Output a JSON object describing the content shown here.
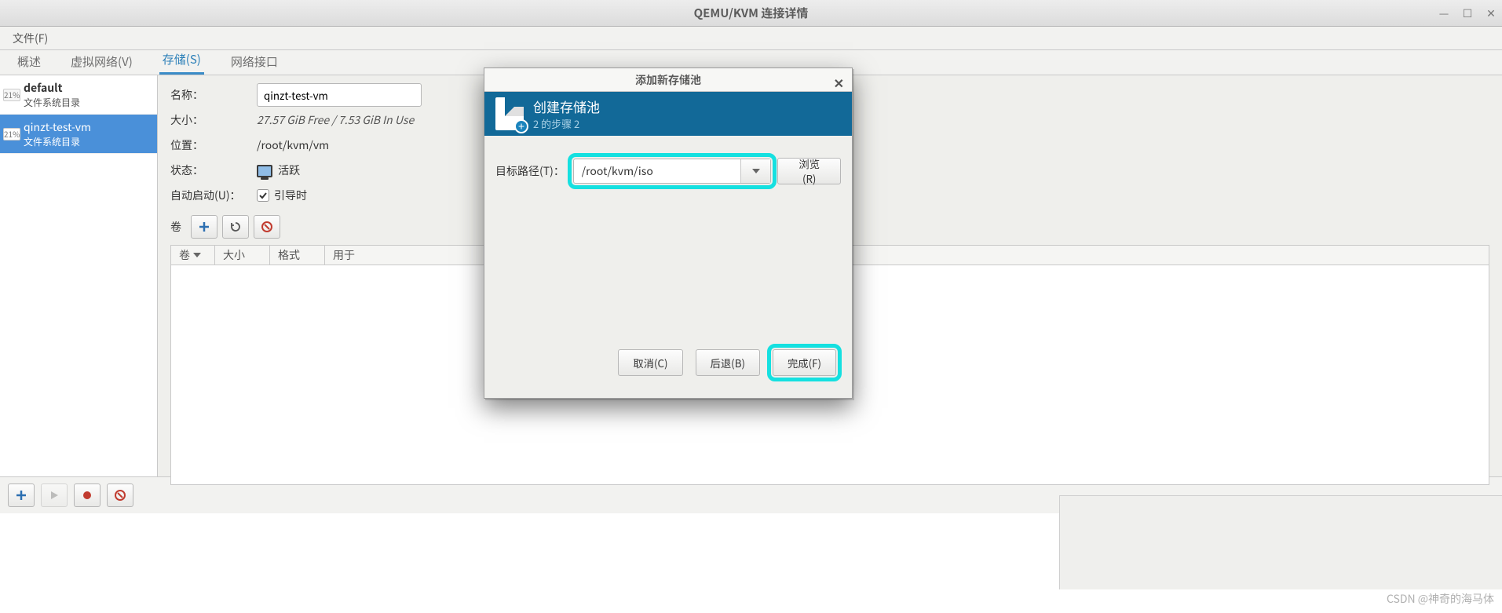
{
  "window": {
    "title": "QEMU/KVM 连接详情",
    "min": "—",
    "max": "☐",
    "close": "✕"
  },
  "menu": {
    "file": "文件(F)"
  },
  "tabs": {
    "overview": "概述",
    "vnet": "虚拟网络(V)",
    "storage": "存储(S)",
    "iface": "网络接口"
  },
  "sidebar": {
    "items": [
      {
        "pct": "21%",
        "name": "default",
        "type": "文件系统目录"
      },
      {
        "pct": "21%",
        "name": "qinzt-test-vm",
        "type": "文件系统目录"
      }
    ]
  },
  "details": {
    "name_label": "名称：",
    "name_value": "qinzt-test-vm",
    "size_label": "大小：",
    "size_value": "27.57 GiB Free / 7.53 GiB In Use",
    "loc_label": "位置：",
    "loc_value": "/root/kvm/vm",
    "state_label": "状态：",
    "state_value": "活跃",
    "auto_label": "自动启动(U)：",
    "auto_value": "引导时",
    "vol_label": "卷",
    "cols": {
      "vol": "卷",
      "size": "大小",
      "fmt": "格式",
      "used": "用于"
    }
  },
  "dialog": {
    "title": "添加新存储池",
    "banner_title": "创建存储池",
    "banner_sub": "2 的步骤 2",
    "target_label": "目标路径(T)：",
    "target_value": "/root/kvm/iso",
    "browse": "浏览(R)",
    "cancel": "取消(C)",
    "back": "后退(B)",
    "finish": "完成(F)"
  },
  "watermark": "CSDN @神奇的海马体"
}
